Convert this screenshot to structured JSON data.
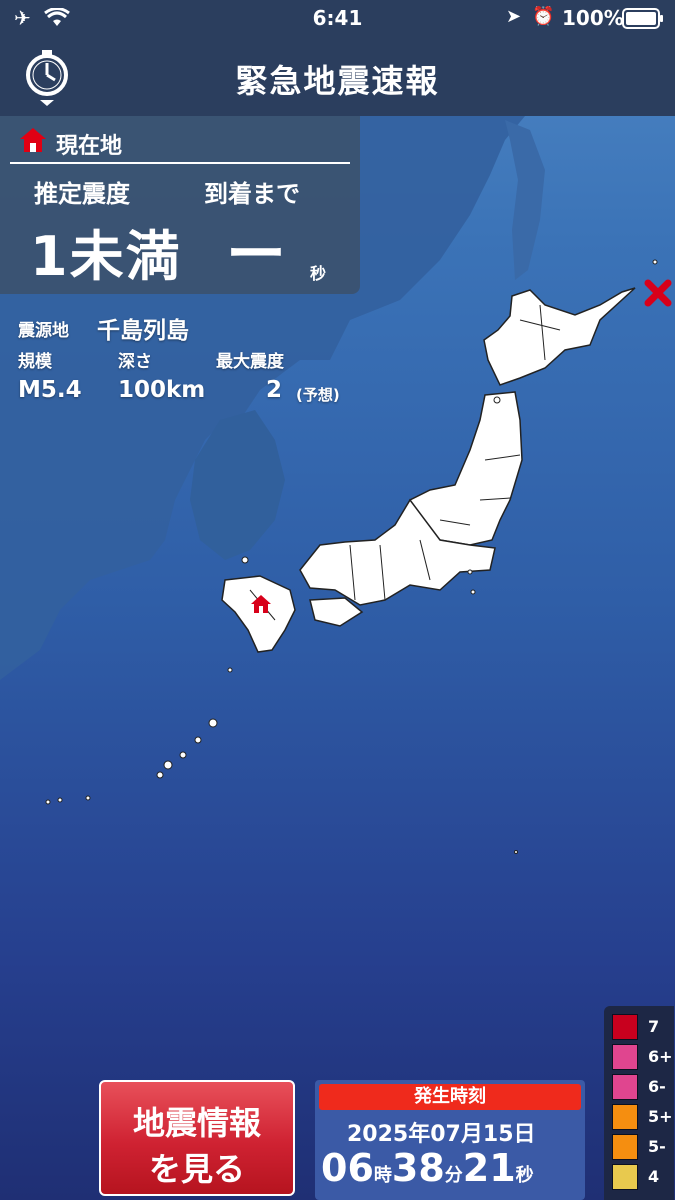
{
  "status": {
    "time": "6:41",
    "battery": "100%"
  },
  "header": {
    "title": "緊急地震速報"
  },
  "panel": {
    "location_label": "現在地",
    "intensity_label": "推定震度",
    "arrival_label": "到着まで",
    "intensity_value": "1未満",
    "arrival_value": "ー",
    "arrival_unit": "秒"
  },
  "quake": {
    "epicenter_label": "震源地",
    "epicenter": "千島列島",
    "magnitude_label": "規模",
    "magnitude": "M5.4",
    "depth_label": "深さ",
    "depth": "100km",
    "max_label": "最大震度",
    "max_value": "2",
    "max_note": "(予想)"
  },
  "button": {
    "line1": "地震情報",
    "line2": "を見る"
  },
  "occurred": {
    "label": "発生時刻",
    "year": "2025",
    "year_unit": "年",
    "month": "07",
    "month_unit": "月",
    "day": "15",
    "day_unit": "日",
    "hour": "06",
    "hour_unit": "時",
    "minute": "38",
    "minute_unit": "分",
    "second": "21",
    "second_unit": "秒"
  },
  "legend": [
    {
      "label": "7",
      "color": "#c8001e"
    },
    {
      "label": "6+",
      "color": "#e0458f"
    },
    {
      "label": "6-",
      "color": "#e0458f"
    },
    {
      "label": "5+",
      "color": "#f58e10"
    },
    {
      "label": "5-",
      "color": "#f58e10"
    },
    {
      "label": "4",
      "color": "#e8c94e"
    }
  ]
}
